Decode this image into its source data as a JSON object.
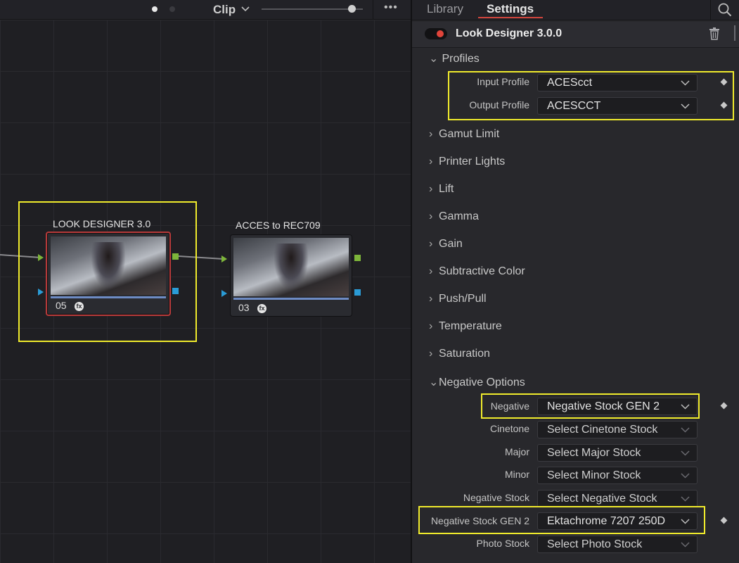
{
  "node_toolbar": {
    "clip_label": "Clip",
    "more_icon": "more-icon"
  },
  "nodes": [
    {
      "title": "LOOK DESIGNER 3.0",
      "number": "05",
      "selected": true,
      "fx_icon": "fx-icon"
    },
    {
      "title": "ACCES to REC709",
      "number": "03",
      "selected": false,
      "fx_icon": "fx-icon"
    }
  ],
  "colors": {
    "highlight": "#f0eb2c",
    "selected_node_border": "#b73a3a",
    "port_green": "#7db53a",
    "port_blue": "#2a9bd6",
    "tab_underline": "#d0453d",
    "toggle_on": "#e0443a"
  },
  "panel": {
    "tabs": [
      {
        "label": "Library",
        "active": false
      },
      {
        "label": "Settings",
        "active": true
      }
    ],
    "search_icon": "search-icon",
    "plugin": {
      "title": "Look Designer 3.0.0",
      "enabled": true,
      "delete_icon": "trash-icon"
    },
    "profiles": {
      "label": "Profiles",
      "expanded": true,
      "rows": [
        {
          "label": "Input Profile",
          "value": "ACEScct"
        },
        {
          "label": "Output Profile",
          "value": "ACESCCT"
        }
      ]
    },
    "sections": [
      {
        "label": "Gamut Limit"
      },
      {
        "label": "Printer Lights"
      },
      {
        "label": "Lift"
      },
      {
        "label": "Gamma"
      },
      {
        "label": "Gain"
      },
      {
        "label": "Subtractive Color"
      },
      {
        "label": "Push/Pull"
      },
      {
        "label": "Temperature"
      },
      {
        "label": "Saturation"
      }
    ],
    "negative_options": {
      "label": "Negative Options",
      "expanded": true,
      "rows": [
        {
          "label": "Negative",
          "value": "Negative Stock GEN 2",
          "keyframe": true
        },
        {
          "label": "Cinetone",
          "value": "Select Cinetone Stock",
          "keyframe": false
        },
        {
          "label": "Major",
          "value": "Select Major Stock",
          "keyframe": false
        },
        {
          "label": "Minor",
          "value": "Select Minor Stock",
          "keyframe": false
        },
        {
          "label": "Negative Stock",
          "value": "Select Negative Stock",
          "keyframe": false
        },
        {
          "label": "Negative Stock GEN 2",
          "value": "Ektachrome 7207 250D",
          "keyframe": true
        },
        {
          "label": "Photo Stock",
          "value": "Select Photo Stock",
          "keyframe": false
        }
      ]
    }
  }
}
